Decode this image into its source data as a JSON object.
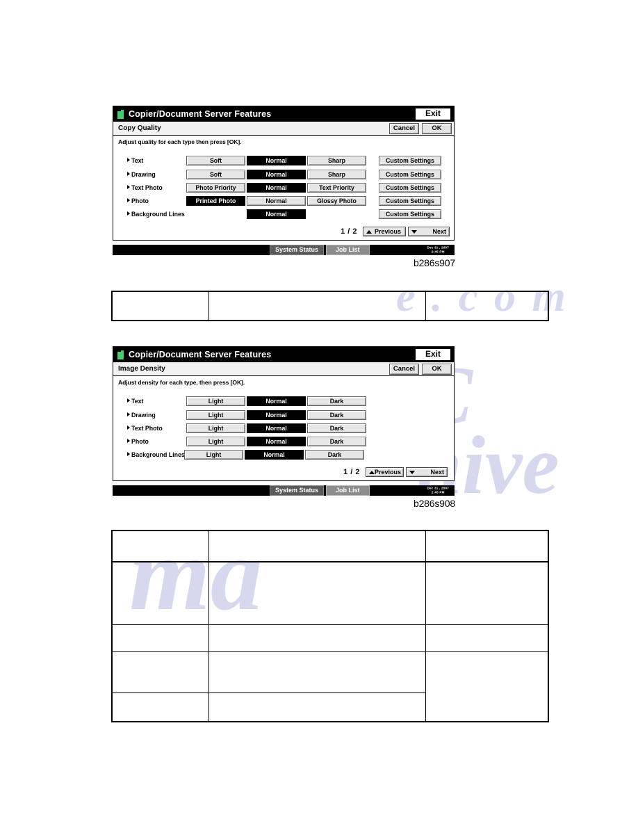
{
  "page": {
    "watermarks": [
      "e . c o m",
      "C",
      "ma",
      "hive"
    ]
  },
  "figures": [
    {
      "id": "fig-copy-quality",
      "caption": "b286s907",
      "titlebar": {
        "icon": "document-server-icon",
        "title": "Copier/Document Server Features",
        "exit_label": "Exit"
      },
      "subbar": {
        "screen_title": "Copy Quality",
        "cancel_label": "Cancel",
        "ok_label": "OK"
      },
      "instruction": "Adjust quality for each type then press [OK].",
      "rows": [
        {
          "label": "Text",
          "options": [
            {
              "label": "Soft",
              "selected": false
            },
            {
              "label": "Normal",
              "selected": true
            },
            {
              "label": "Sharp",
              "selected": false
            }
          ],
          "custom_label": "Custom Settings"
        },
        {
          "label": "Drawing",
          "options": [
            {
              "label": "Soft",
              "selected": false
            },
            {
              "label": "Normal",
              "selected": true
            },
            {
              "label": "Sharp",
              "selected": false
            }
          ],
          "custom_label": "Custom Settings"
        },
        {
          "label": "Text Photo",
          "options": [
            {
              "label": "Photo Priority",
              "selected": false
            },
            {
              "label": "Normal",
              "selected": true
            },
            {
              "label": "Text Priority",
              "selected": false
            }
          ],
          "custom_label": "Custom Settings"
        },
        {
          "label": "Photo",
          "options": [
            {
              "label": "Printed Photo",
              "selected": true
            },
            {
              "label": "Normal",
              "selected": false
            },
            {
              "label": "Glossy Photo",
              "selected": false
            }
          ],
          "custom_label": "Custom Settings"
        },
        {
          "label": "Background Lines",
          "options": [
            {
              "label": "",
              "selected": false,
              "hidden": true
            },
            {
              "label": "Normal",
              "selected": true
            },
            {
              "label": "",
              "selected": false,
              "hidden": true
            }
          ],
          "custom_label": "Custom Settings"
        }
      ],
      "pagination": {
        "page_indicator": "1 / 2",
        "previous_label": "Previous",
        "next_label": "Next",
        "previous_tight": false
      },
      "statusbar": {
        "system_status_label": "System Status",
        "job_list_label": "Job List",
        "date": "Dec 31 , 2007",
        "time": "2:45 PM"
      }
    },
    {
      "id": "fig-image-density",
      "caption": "b286s908",
      "titlebar": {
        "icon": "document-server-icon",
        "title": "Copier/Document Server Features",
        "exit_label": "Exit"
      },
      "subbar": {
        "screen_title": "Image Density",
        "cancel_label": "Cancel",
        "ok_label": "OK"
      },
      "instruction": "Adjust density for each type, then press [OK].",
      "rows": [
        {
          "label": "Text",
          "options": [
            {
              "label": "Light",
              "selected": false
            },
            {
              "label": "Normal",
              "selected": true
            },
            {
              "label": "Dark",
              "selected": false
            }
          ]
        },
        {
          "label": "Drawing",
          "options": [
            {
              "label": "Light",
              "selected": false
            },
            {
              "label": "Normal",
              "selected": true
            },
            {
              "label": "Dark",
              "selected": false
            }
          ]
        },
        {
          "label": "Text Photo",
          "options": [
            {
              "label": "Light",
              "selected": false
            },
            {
              "label": "Normal",
              "selected": true
            },
            {
              "label": "Dark",
              "selected": false
            }
          ]
        },
        {
          "label": "Photo",
          "options": [
            {
              "label": "Light",
              "selected": false
            },
            {
              "label": "Normal",
              "selected": true
            },
            {
              "label": "Dark",
              "selected": false
            }
          ]
        },
        {
          "label": "Background Lines",
          "options": [
            {
              "label": "Light",
              "selected": false
            },
            {
              "label": "Normal",
              "selected": true
            },
            {
              "label": "Dark",
              "selected": false
            }
          ]
        }
      ],
      "pagination": {
        "page_indicator": "1 / 2",
        "previous_label": "Previous",
        "next_label": "Next",
        "previous_tight": true
      },
      "statusbar": {
        "system_status_label": "System Status",
        "job_list_label": "Job List",
        "date": "Dec 31 , 2007",
        "time": "2:45 PM"
      }
    }
  ],
  "tables": [
    {
      "id": "table-upper",
      "rows": [
        [
          {
            "text": ""
          },
          {
            "text": ""
          },
          {
            "text": ""
          }
        ]
      ]
    },
    {
      "id": "table-lower",
      "rows": [
        [
          {
            "text": ""
          },
          {
            "text": ""
          },
          {
            "text": ""
          }
        ],
        [
          {
            "text": ""
          },
          {
            "text": ""
          },
          {
            "text": ""
          }
        ],
        [
          {
            "text": ""
          },
          {
            "text": ""
          },
          {
            "text": ""
          }
        ],
        [
          {
            "text": ""
          },
          {
            "text": ""
          },
          {
            "text": ""
          }
        ],
        [
          {
            "text": ""
          },
          {
            "text": ""
          }
        ]
      ]
    }
  ]
}
